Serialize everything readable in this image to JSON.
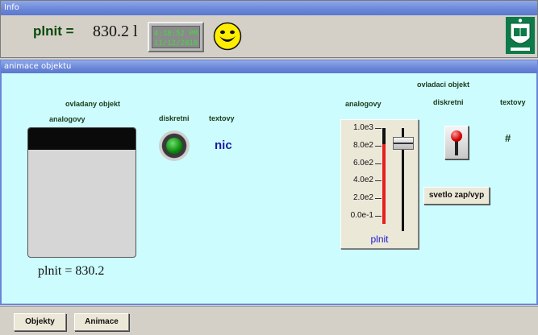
{
  "info": {
    "title": "Info",
    "label": "plnit =",
    "value": "830.2 l",
    "clock_time": "4:18:52 PM",
    "clock_date": "11/12/2010"
  },
  "animace": {
    "title": "animace objektu",
    "ovladany_header": "ovladany objekt",
    "analogovy_left": "analogovy",
    "diskretni_left": "diskretni",
    "textovy_left": "textovy",
    "tank_caption": "plnit = 830.2",
    "tank_level": 0.17,
    "text_value": "nic",
    "ovladaci_header": "ovladaci objekt",
    "analogovy_right": "analogovy",
    "diskretni_right": "diskretni",
    "textovy_right": "textovy",
    "slider": {
      "ticks": [
        "1.0e3",
        "8.0e2",
        "6.0e2",
        "4.0e2",
        "2.0e2",
        "0.0e-1"
      ],
      "max": 1000,
      "value": 830.2,
      "caption": "plnit"
    },
    "toggle_button_label": "svetlo zap/vyp",
    "text_output": "#"
  },
  "bottom": {
    "objekty_label": "Objekty",
    "animace_label": "Animace"
  },
  "colors": {
    "titlebar": "#6a86d8",
    "panel_bg": "#ccfcfe",
    "lamp": "#0a8a0a",
    "bar": "#e61e1e"
  }
}
